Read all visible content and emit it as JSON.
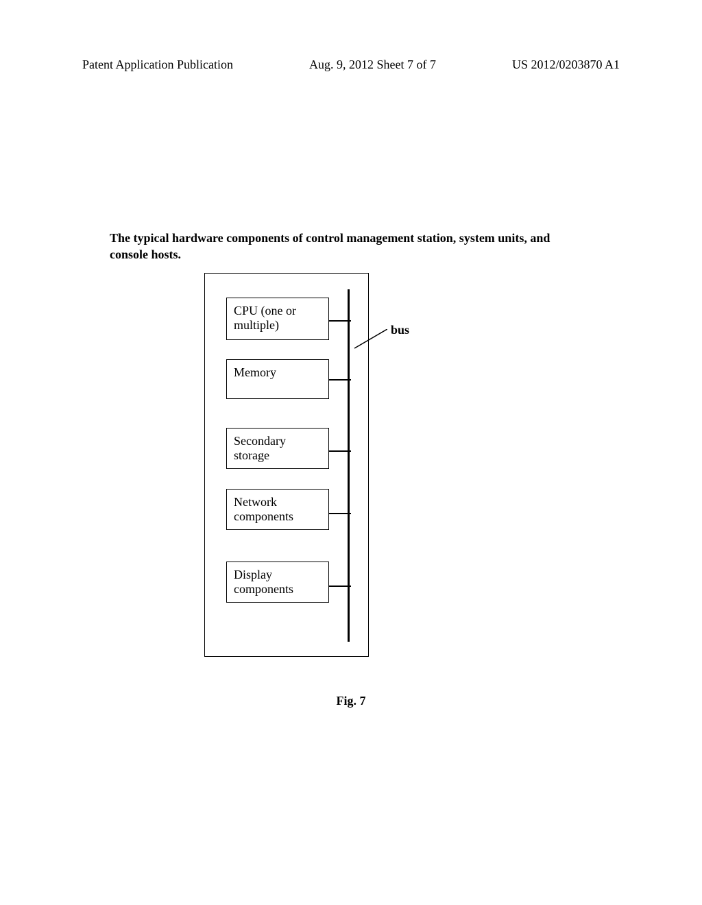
{
  "header": {
    "left": "Patent Application Publication",
    "center": "Aug. 9, 2012  Sheet 7 of 7",
    "right": "US 2012/0203870 A1"
  },
  "caption": "The typical hardware components of control management station, system units, and console hosts.",
  "components": {
    "cpu": "CPU (one or multiple)",
    "memory": "Memory",
    "storage": "Secondary storage",
    "network": "Network components",
    "display": "Display components"
  },
  "bus_label": "bus",
  "figure_label": "Fig. 7"
}
